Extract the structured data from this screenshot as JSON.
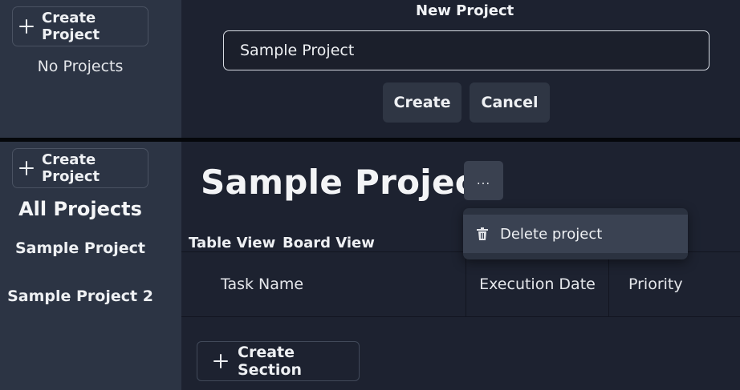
{
  "top_panel": {
    "sidebar": {
      "create_project_label": "Create Project",
      "empty_text": "No Projects"
    },
    "form": {
      "title": "New Project",
      "name_value": "Sample Project",
      "create_label": "Create",
      "cancel_label": "Cancel"
    }
  },
  "bottom_panel": {
    "sidebar": {
      "create_project_label": "Create Project",
      "heading": "All Projects",
      "items": [
        {
          "label": "Sample Project"
        },
        {
          "label": "Sample Project 2"
        }
      ]
    },
    "main": {
      "project_title": "Sample Project",
      "more_icon": "...",
      "tabs": [
        {
          "label": "Table View"
        },
        {
          "label": "Board View"
        }
      ],
      "columns": [
        {
          "label": "Task Name"
        },
        {
          "label": "Execution Date"
        },
        {
          "label": "Priority"
        }
      ],
      "create_section_label": "Create Section"
    },
    "dropdown": {
      "items": [
        {
          "label": "Delete project",
          "icon": "trash-icon"
        }
      ]
    }
  },
  "colors": {
    "sidebar_bg": "#2c3444",
    "main_bg": "#1d2230",
    "divider": "#05070b",
    "button_bg": "#2f3644",
    "dropdown_bg": "#2b3240",
    "menu_item_active": "#3a4252",
    "text": "#eef0f3"
  }
}
